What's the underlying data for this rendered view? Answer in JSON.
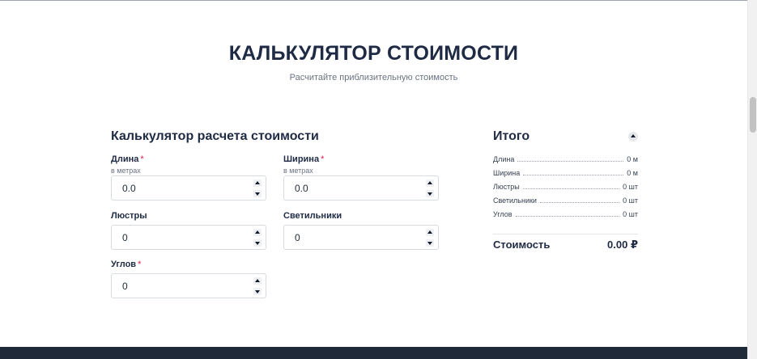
{
  "header": {
    "title": "КАЛЬКУЛЯТОР СТОИМОСТИ",
    "subtitle": "Расчитайте приблизительную стоимость"
  },
  "calculator": {
    "title": "Калькулятор расчета стоимости",
    "fields": {
      "length": {
        "label": "Длина",
        "required_mark": "*",
        "hint": "в метрах",
        "value": "0.0"
      },
      "width": {
        "label": "Ширина",
        "required_mark": "*",
        "hint": "в метрах",
        "value": "0.0"
      },
      "chandeliers": {
        "label": "Люстры",
        "value": "0"
      },
      "lamps": {
        "label": "Светильники",
        "value": "0"
      },
      "corners": {
        "label": "Углов",
        "required_mark": "*",
        "value": "0"
      }
    }
  },
  "summary": {
    "title": "Итого",
    "rows": [
      {
        "key": "Длина",
        "value": "0 м"
      },
      {
        "key": "Ширина",
        "value": "0 м"
      },
      {
        "key": "Люстры",
        "value": "0 шт"
      },
      {
        "key": "Светильники",
        "value": "0 шт"
      },
      {
        "key": "Углов",
        "value": "0 шт"
      }
    ],
    "total_label": "Стоимость",
    "total_value": "0.00 ₽"
  },
  "colors": {
    "heading": "#1f2a44",
    "required": "#e11d48",
    "footer": "#1f2937"
  }
}
